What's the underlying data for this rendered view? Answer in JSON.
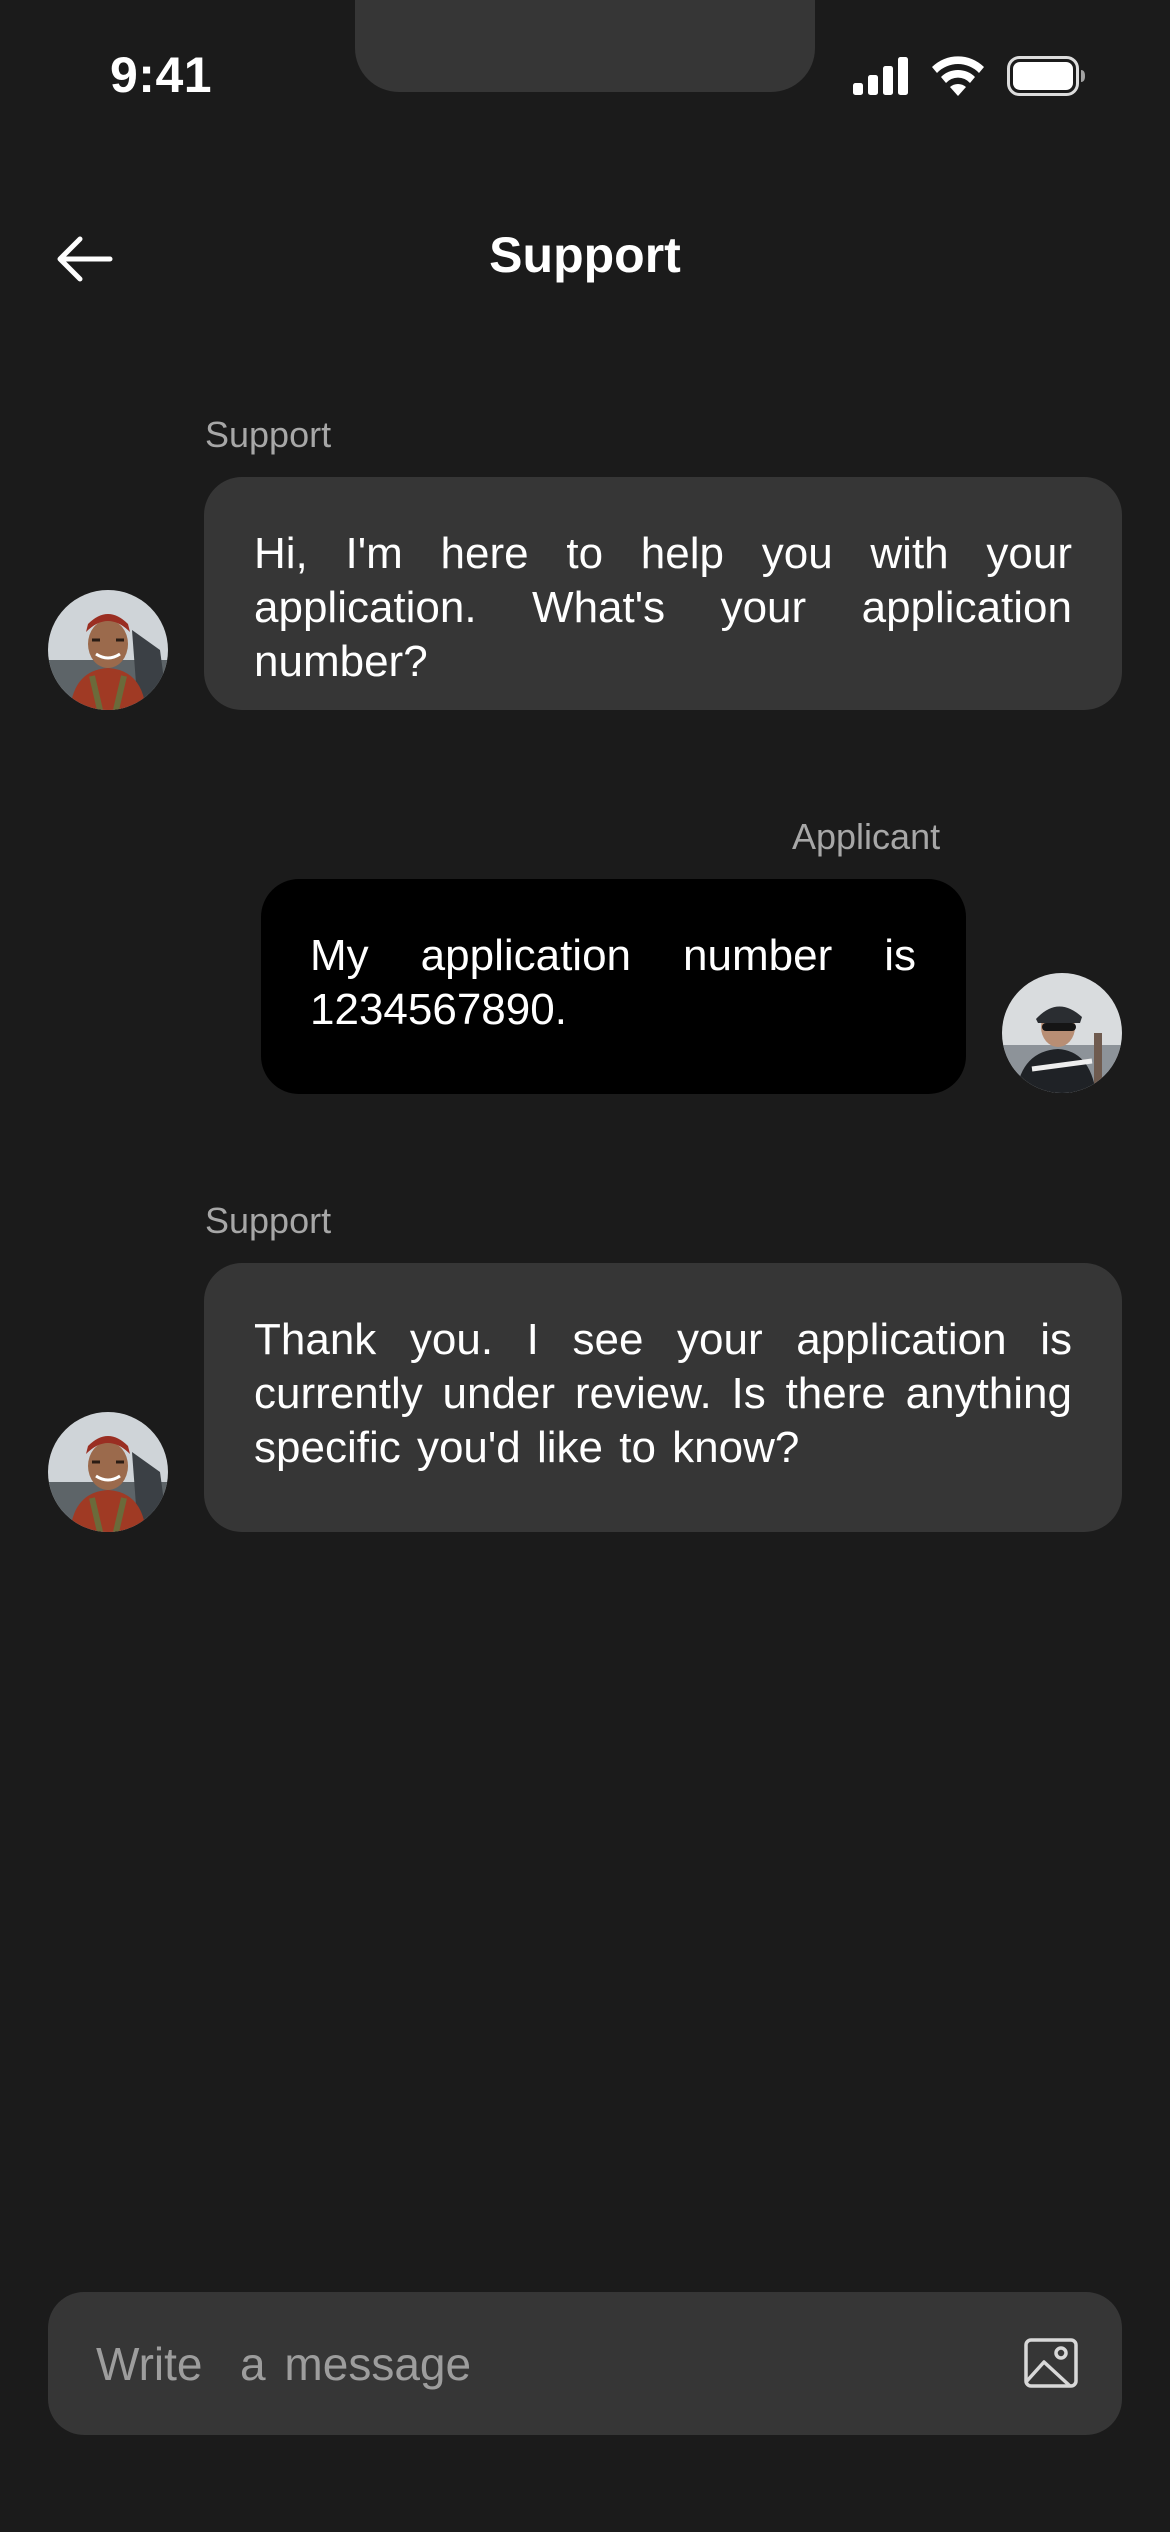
{
  "status_bar": {
    "time": "9:41"
  },
  "header": {
    "title": "Support",
    "back_icon": "arrow-left-icon"
  },
  "messages": [
    {
      "sender": "Support",
      "text": "Hi, I'm here to help you with your application. What's your application number?",
      "side": "left"
    },
    {
      "sender": "Applicant",
      "text": "My application number is 1234567890.",
      "side": "right"
    },
    {
      "sender": "Support",
      "text": "Thank you. I see your application is currently under review. Is there anything specific you'd like to know?",
      "side": "left"
    }
  ],
  "composer": {
    "placeholder": "Write  a message",
    "value": "",
    "attach_icon": "image-icon"
  },
  "colors": {
    "background": "#1b1b1b",
    "support_bubble": "#363636",
    "applicant_bubble": "#000000",
    "label_text": "#a7a7a7"
  }
}
